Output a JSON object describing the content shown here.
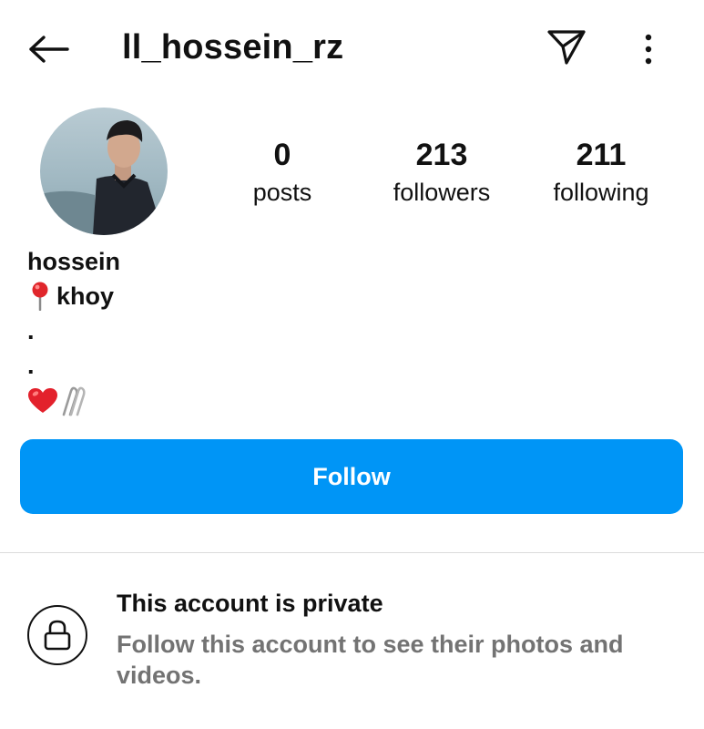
{
  "header": {
    "username": "ll_hossein_rz",
    "back_icon": "arrow-left-icon",
    "send_icon": "paper-plane-icon",
    "more_icon": "vertical-dots-icon"
  },
  "profile": {
    "avatar_icon": "profile-photo",
    "stats": {
      "posts": {
        "count": "0",
        "label": "posts"
      },
      "followers": {
        "count": "213",
        "label": "followers"
      },
      "following": {
        "count": "211",
        "label": "following"
      }
    }
  },
  "bio": {
    "name": "hossein",
    "location_icon": "round-pushpin-icon",
    "location": "khoy",
    "dot1": ".",
    "dot2": ".",
    "emoji_icons": [
      "red-heart-icon",
      "paperclips-icon"
    ]
  },
  "actions": {
    "follow_label": "Follow"
  },
  "private_notice": {
    "lock_icon": "lock-icon",
    "title": "This account is private",
    "description": "Follow this account to see their photos and videos."
  },
  "colors": {
    "primary_button": "#0095f6",
    "secondary_text": "#737373",
    "divider": "#dbdbdb",
    "text": "#111111"
  }
}
